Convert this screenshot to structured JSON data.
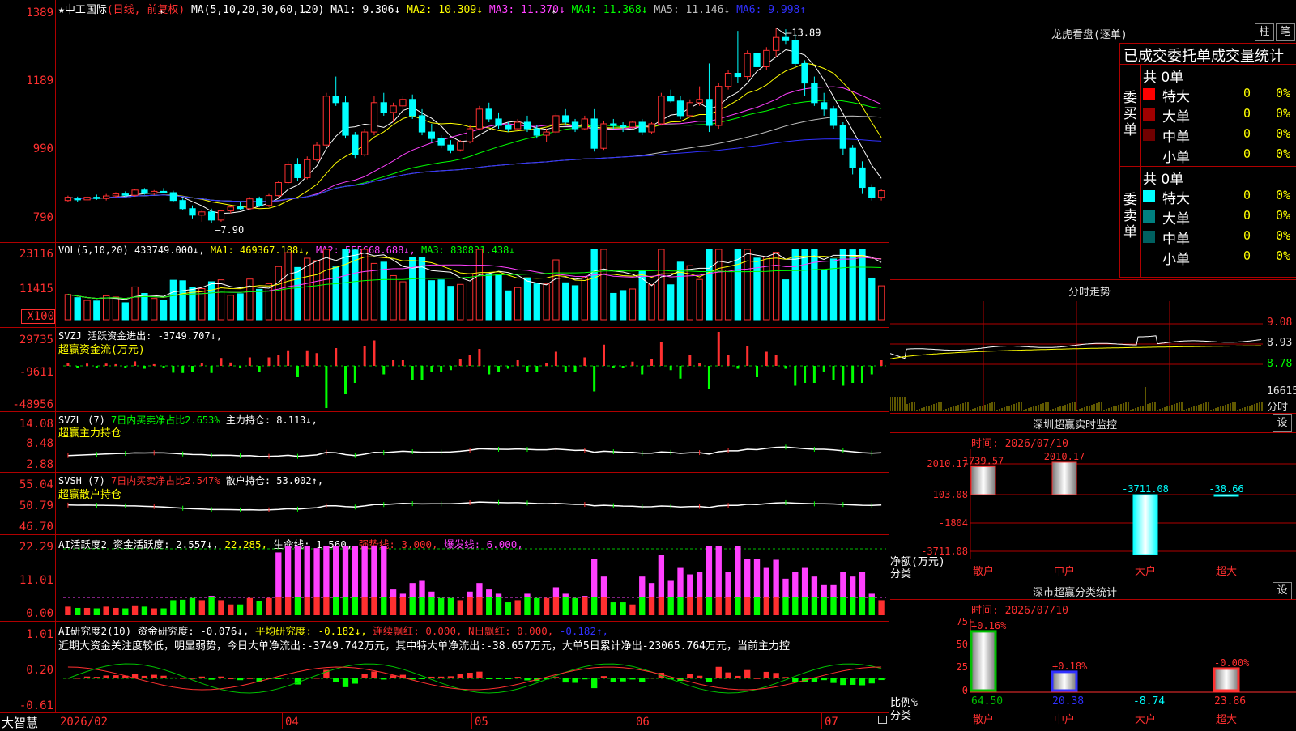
{
  "stock": {
    "name": "中工国际",
    "mode": "(日线, 前复权)",
    "ma_label": "MA(5,10,20,30,60,120)",
    "ma_items": [
      {
        "label": "MA1: 9.306↓",
        "color": "#ffffff"
      },
      {
        "label": "MA2: 10.309↓",
        "color": "#ffff00"
      },
      {
        "label": "MA3: 11.370↓",
        "color": "#ff40ff"
      },
      {
        "label": "MA4: 11.368↓",
        "color": "#00ff00"
      },
      {
        "label": "MA5: 11.146↓",
        "color": "#c0c0c0"
      },
      {
        "label": "MA6: 9.998↑",
        "color": "#3030ff"
      }
    ],
    "high_label": "13.89",
    "low_label": "7.90"
  },
  "axes": {
    "price": [
      "1389",
      "1189",
      "990",
      "790"
    ],
    "vol": [
      "23116",
      "11415",
      "X100"
    ],
    "svzj": [
      "29735",
      "-9611",
      "-48956"
    ],
    "svzl": [
      "14.08",
      "8.48",
      "2.88"
    ],
    "svsh": [
      "55.04",
      "50.79",
      "46.70"
    ],
    "ai": [
      "22.29",
      "11.01",
      "0.00"
    ],
    "aiyj": [
      "1.01",
      "0.20",
      "-0.61"
    ]
  },
  "indicators": {
    "vol": {
      "prefix": "VOL(5,10,20)",
      "v": "433749.000↓,",
      "ma1": "MA1: 469367.188↓,",
      "ma2": "MA2: 555668.688↓,",
      "ma3": "MA3: 830831.438↓"
    },
    "svzj": {
      "line1": "SVZJ  活跃资金进出: -3749.707↓,",
      "line2": "超赢资金流(万元)"
    },
    "svzl": {
      "p1": "SVZL (7) ",
      "p2": "7日内买卖净占比2.653%",
      "p3": " 主力持仓: 8.113↓,",
      "line2": "超赢主力持仓"
    },
    "svsh": {
      "p1": "SVSH (7) ",
      "p2": "7日内买卖净占比2.547%",
      "p3": " 散户持仓: 53.002↑,",
      "line2": "超赢散户持仓"
    },
    "ai": {
      "p1": "AI活跃度2 资金活跃度: 2.557↓,",
      "p2": "22.285,",
      "p3": "生命线: 1.560,",
      "p4": "强势线: 3.000,",
      "p5": "爆发线: 6.000,"
    },
    "aiyj": {
      "p1": "AI研究度2(10) 资金研究度: -0.076↓,",
      "p2": "平均研究度: -0.182↓,",
      "p3": "连续飘红: 0.000,",
      "p4": "N日飘红: 0.000,",
      "p5": "-0.182↑,",
      "comment": "近期大资金关注度较低，明显弱势，今日大单净流出:-3749.742万元，其中特大单净流出:-38.657万元，大单5日累计净出-23065.764万元，当前主力控"
    }
  },
  "timeline": {
    "brand": "大智慧",
    "labels": [
      {
        "text": "2026/02"
      },
      {
        "text": "04"
      },
      {
        "text": "05"
      },
      {
        "text": "06"
      },
      {
        "text": "07"
      }
    ]
  },
  "right": {
    "lhb_title": "龙虎看盘(逐单)",
    "btn_bar": "柱",
    "btn_bi": "笔",
    "order_header": "已成交委托单成交量统计",
    "buy": {
      "side": "委买单",
      "total": "共 0单",
      "rows": [
        {
          "label": "特大",
          "val": "0",
          "pct": "0%",
          "color": "#ff0000"
        },
        {
          "label": "大单",
          "val": "0",
          "pct": "0%",
          "color": "#a00000"
        },
        {
          "label": "中单",
          "val": "0",
          "pct": "0%",
          "color": "#700000"
        },
        {
          "label": "小单",
          "val": "0",
          "pct": "0%",
          "color": "#000000"
        }
      ]
    },
    "sell": {
      "side": "委卖单",
      "total": "共 0单",
      "rows": [
        {
          "label": "特大",
          "val": "0",
          "pct": "0%",
          "color": "#00ffff"
        },
        {
          "label": "大单",
          "val": "0",
          "pct": "0%",
          "color": "#008080"
        },
        {
          "label": "中单",
          "val": "0",
          "pct": "0%",
          "color": "#006060"
        },
        {
          "label": "小单",
          "val": "0",
          "pct": "0%",
          "color": "#000000"
        }
      ]
    },
    "fenshi": {
      "title": "分时走势",
      "p_hi": "9.08",
      "p_mid": "8.93",
      "p_lo": "8.78",
      "vol": "16615",
      "vol_unit": "分时"
    },
    "monitor": {
      "title": "深圳超赢实时监控",
      "btn": "设",
      "time": "时间: 2026/07/10",
      "yaxis": [
        "2010.17",
        "103.08",
        "-1804",
        "-3711.08"
      ],
      "ylabel1": "净额(万元)",
      "ylabel2": "分类",
      "cats": [
        "散户",
        "中户",
        "大户",
        "超大"
      ],
      "values": [
        "1739.57",
        "2010.17",
        "-3711.08",
        "-38.66"
      ]
    },
    "classstat": {
      "title": "深市超赢分类统计",
      "btn": "设",
      "time": "时间: 2026/07/10",
      "yaxis": [
        "75",
        "50",
        "25",
        "0"
      ],
      "ylabel1": "比例%",
      "ylabel2": "分类",
      "cats": [
        "散户",
        "中户",
        "大户",
        "超大"
      ],
      "tops": [
        "+0.16%",
        "+0.18%",
        "",
        "-0.00%"
      ],
      "values": [
        "64.50",
        "20.38",
        "-8.74",
        "23.86"
      ]
    }
  },
  "chart_data": [
    {
      "type": "candlestick",
      "title": "中工国际 (日线, 前复权)",
      "ylim": [
        7.5,
        14.3
      ],
      "annotations": [
        {
          "text": "13.89",
          "kind": "high"
        },
        {
          "text": "7.90",
          "kind": "low"
        }
      ],
      "ohlc": [
        [
          8.6,
          8.75,
          8.55,
          8.7
        ],
        [
          8.65,
          8.72,
          8.55,
          8.62
        ],
        [
          8.62,
          8.75,
          8.58,
          8.7
        ],
        [
          8.7,
          8.78,
          8.62,
          8.66
        ],
        [
          8.66,
          8.8,
          8.6,
          8.74
        ],
        [
          8.74,
          8.85,
          8.68,
          8.8
        ],
        [
          8.8,
          8.88,
          8.72,
          8.76
        ],
        [
          8.76,
          8.95,
          8.72,
          8.92
        ],
        [
          8.92,
          8.98,
          8.78,
          8.82
        ],
        [
          8.82,
          8.92,
          8.76,
          8.88
        ],
        [
          8.88,
          8.98,
          8.82,
          8.84
        ],
        [
          8.84,
          8.9,
          8.55,
          8.6
        ],
        [
          8.6,
          8.66,
          8.3,
          8.35
        ],
        [
          8.35,
          8.45,
          8.05,
          8.15
        ],
        [
          8.15,
          8.3,
          7.95,
          8.25
        ],
        [
          8.25,
          8.35,
          7.9,
          8.0
        ],
        [
          8.0,
          8.3,
          7.95,
          8.28
        ],
        [
          8.28,
          8.45,
          8.2,
          8.4
        ],
        [
          8.4,
          8.55,
          8.3,
          8.35
        ],
        [
          8.35,
          8.7,
          8.3,
          8.65
        ],
        [
          8.65,
          8.72,
          8.4,
          8.45
        ],
        [
          8.45,
          8.8,
          8.4,
          8.75
        ],
        [
          8.75,
          9.2,
          8.7,
          9.15
        ],
        [
          9.15,
          9.8,
          9.1,
          9.7
        ],
        [
          9.7,
          9.9,
          9.2,
          9.3
        ],
        [
          9.3,
          9.95,
          9.25,
          9.85
        ],
        [
          9.85,
          10.4,
          9.8,
          10.3
        ],
        [
          10.3,
          11.9,
          10.25,
          11.8
        ],
        [
          11.8,
          12.4,
          11.5,
          11.6
        ],
        [
          11.6,
          11.8,
          10.5,
          10.6
        ],
        [
          10.6,
          10.7,
          9.9,
          10.0
        ],
        [
          10.0,
          10.8,
          9.95,
          10.7
        ],
        [
          10.7,
          11.8,
          10.6,
          11.6
        ],
        [
          11.6,
          11.9,
          11.2,
          11.3
        ],
        [
          11.3,
          11.6,
          11.0,
          11.5
        ],
        [
          11.5,
          11.8,
          11.3,
          11.7
        ],
        [
          11.7,
          11.85,
          11.1,
          11.2
        ],
        [
          11.2,
          11.4,
          10.6,
          10.7
        ],
        [
          10.7,
          10.95,
          10.4,
          10.5
        ],
        [
          10.5,
          10.6,
          10.2,
          10.3
        ],
        [
          10.3,
          10.45,
          10.05,
          10.15
        ],
        [
          10.15,
          10.45,
          10.1,
          10.4
        ],
        [
          10.4,
          10.9,
          10.35,
          10.8
        ],
        [
          10.8,
          11.5,
          10.75,
          11.4
        ],
        [
          11.4,
          11.6,
          11.0,
          11.1
        ],
        [
          11.1,
          11.3,
          10.8,
          10.9
        ],
        [
          10.9,
          11.0,
          10.7,
          10.8
        ],
        [
          10.8,
          11.1,
          10.75,
          11.0
        ],
        [
          11.0,
          11.2,
          10.7,
          10.8
        ],
        [
          10.8,
          10.9,
          10.5,
          10.6
        ],
        [
          10.6,
          10.8,
          10.4,
          10.7
        ],
        [
          10.7,
          11.3,
          10.65,
          11.2
        ],
        [
          11.2,
          11.4,
          10.9,
          11.0
        ],
        [
          11.0,
          11.1,
          10.7,
          10.8
        ],
        [
          10.8,
          11.2,
          10.75,
          11.1
        ],
        [
          11.1,
          11.4,
          10.1,
          10.2
        ],
        [
          10.2,
          11.05,
          10.15,
          10.95
        ],
        [
          10.95,
          11.1,
          10.8,
          10.9
        ],
        [
          10.9,
          11.0,
          10.7,
          10.85
        ],
        [
          10.85,
          11.05,
          10.8,
          11.0
        ],
        [
          11.0,
          11.1,
          10.6,
          10.7
        ],
        [
          10.7,
          11.0,
          10.65,
          10.95
        ],
        [
          10.95,
          11.9,
          10.9,
          11.8
        ],
        [
          11.8,
          12.0,
          11.6,
          11.65
        ],
        [
          11.65,
          11.8,
          11.1,
          11.2
        ],
        [
          11.2,
          11.7,
          11.15,
          11.6
        ],
        [
          11.6,
          12.1,
          11.5,
          11.7
        ],
        [
          11.7,
          12.8,
          10.7,
          10.9
        ],
        [
          10.9,
          12.2,
          10.8,
          12.1
        ],
        [
          12.1,
          12.6,
          12.0,
          12.5
        ],
        [
          12.5,
          13.8,
          12.2,
          12.4
        ],
        [
          12.4,
          13.2,
          12.3,
          13.1
        ],
        [
          13.1,
          13.5,
          12.6,
          12.7
        ],
        [
          12.7,
          13.3,
          12.6,
          13.2
        ],
        [
          13.2,
          13.89,
          13.0,
          13.6
        ],
        [
          13.6,
          13.85,
          13.4,
          13.5
        ],
        [
          13.5,
          13.7,
          12.7,
          12.8
        ],
        [
          12.8,
          12.9,
          11.8,
          12.2
        ],
        [
          12.2,
          12.4,
          11.5,
          11.6
        ],
        [
          11.6,
          11.9,
          11.2,
          11.4
        ],
        [
          11.4,
          11.5,
          10.8,
          10.9
        ],
        [
          10.9,
          11.0,
          10.0,
          10.2
        ],
        [
          10.2,
          10.3,
          9.4,
          9.6
        ],
        [
          9.6,
          9.8,
          8.8,
          9.0
        ],
        [
          9.0,
          9.1,
          8.6,
          8.7
        ],
        [
          8.7,
          8.95,
          8.6,
          8.9
        ]
      ]
    }
  ]
}
